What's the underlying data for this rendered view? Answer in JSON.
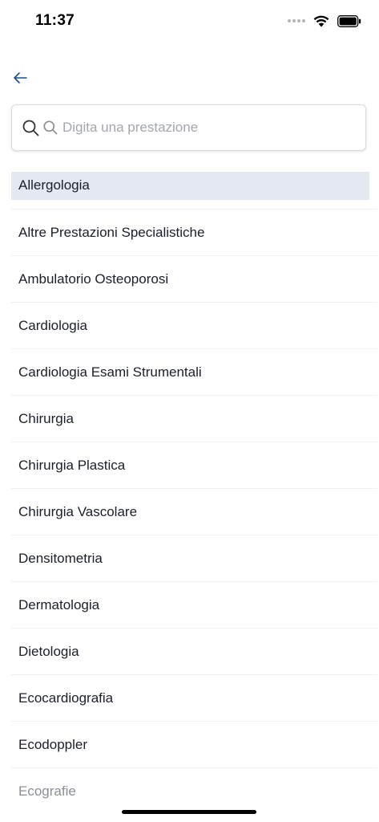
{
  "status_bar": {
    "time": "11:37"
  },
  "search": {
    "placeholder": "Digita una prestazione",
    "value": ""
  },
  "list": {
    "items": [
      "Allergologia",
      "Altre Prestazioni Specialistiche",
      "Ambulatorio Osteoporosi",
      "Cardiologia",
      "Cardiologia Esami Strumentali",
      "Chirurgia",
      "Chirurgia Plastica",
      "Chirurgia Vascolare",
      "Densitometria",
      "Dermatologia",
      "Dietologia",
      "Ecocardiografia",
      "Ecodoppler",
      "Ecografie"
    ],
    "selected_index": 0
  },
  "colors": {
    "accent": "#1f4e8c",
    "selected_bg": "#e4e9f1"
  }
}
